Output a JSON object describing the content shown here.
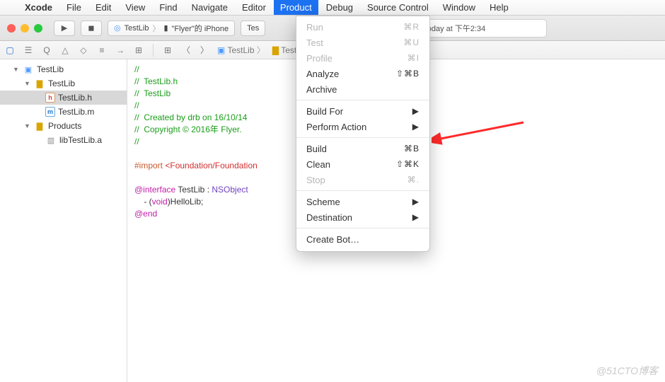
{
  "menubar": {
    "app": "Xcode",
    "items": [
      "File",
      "Edit",
      "View",
      "Find",
      "Navigate",
      "Editor",
      "Product",
      "Debug",
      "Source Control",
      "Window",
      "Help"
    ],
    "active_index": 6
  },
  "toolbar": {
    "scheme_target": "TestLib",
    "scheme_device": "\"Flyer\"的 iPhone",
    "status_prefix": "Tes",
    "status_text": "Today at 下午2:34"
  },
  "sidebar": {
    "project": "TestLib",
    "group": "TestLib",
    "files": [
      "TestLib.h",
      "TestLib.m"
    ],
    "products_group": "Products",
    "product": "libTestLib.a",
    "selected": "TestLib.h"
  },
  "jumpbar": {
    "crumbs": [
      "TestLib",
      "TestLib"
    ]
  },
  "code": {
    "l1": "//",
    "l2": "//  TestLib.h",
    "l3": "//  TestLib",
    "l4": "//",
    "l5": "//  Created by drb on 16/10/14",
    "l6": "//  Copyright © 2016年 Flyer. ",
    "l7": "//",
    "imp_a": "#import ",
    "imp_b": "<Foundation/Foundation",
    "iface_a": "@interface",
    "iface_b": " TestLib : ",
    "iface_c": "NSObject",
    "meth_a": "    - (",
    "meth_b": "void",
    "meth_c": ")HelloLib;",
    "end": "@end"
  },
  "dropdown": {
    "items": [
      {
        "label": "Run",
        "shortcut": "⌘R",
        "disabled": true
      },
      {
        "label": "Test",
        "shortcut": "⌘U",
        "disabled": true
      },
      {
        "label": "Profile",
        "shortcut": "⌘I",
        "disabled": true
      },
      {
        "label": "Analyze",
        "shortcut": "⇧⌘B",
        "disabled": false
      },
      {
        "label": "Archive",
        "shortcut": "",
        "disabled": false
      },
      {
        "sep": true
      },
      {
        "label": "Build For",
        "shortcut": "▶",
        "disabled": false
      },
      {
        "label": "Perform Action",
        "shortcut": "▶",
        "disabled": false
      },
      {
        "sep": true
      },
      {
        "label": "Build",
        "shortcut": "⌘B",
        "disabled": false
      },
      {
        "label": "Clean",
        "shortcut": "⇧⌘K",
        "disabled": false
      },
      {
        "label": "Stop",
        "shortcut": "⌘.",
        "disabled": true
      },
      {
        "sep": true
      },
      {
        "label": "Scheme",
        "shortcut": "▶",
        "disabled": false
      },
      {
        "label": "Destination",
        "shortcut": "▶",
        "disabled": false
      },
      {
        "sep": true
      },
      {
        "label": "Create Bot…",
        "shortcut": "",
        "disabled": false
      }
    ]
  },
  "watermark": "@51CTO博客"
}
